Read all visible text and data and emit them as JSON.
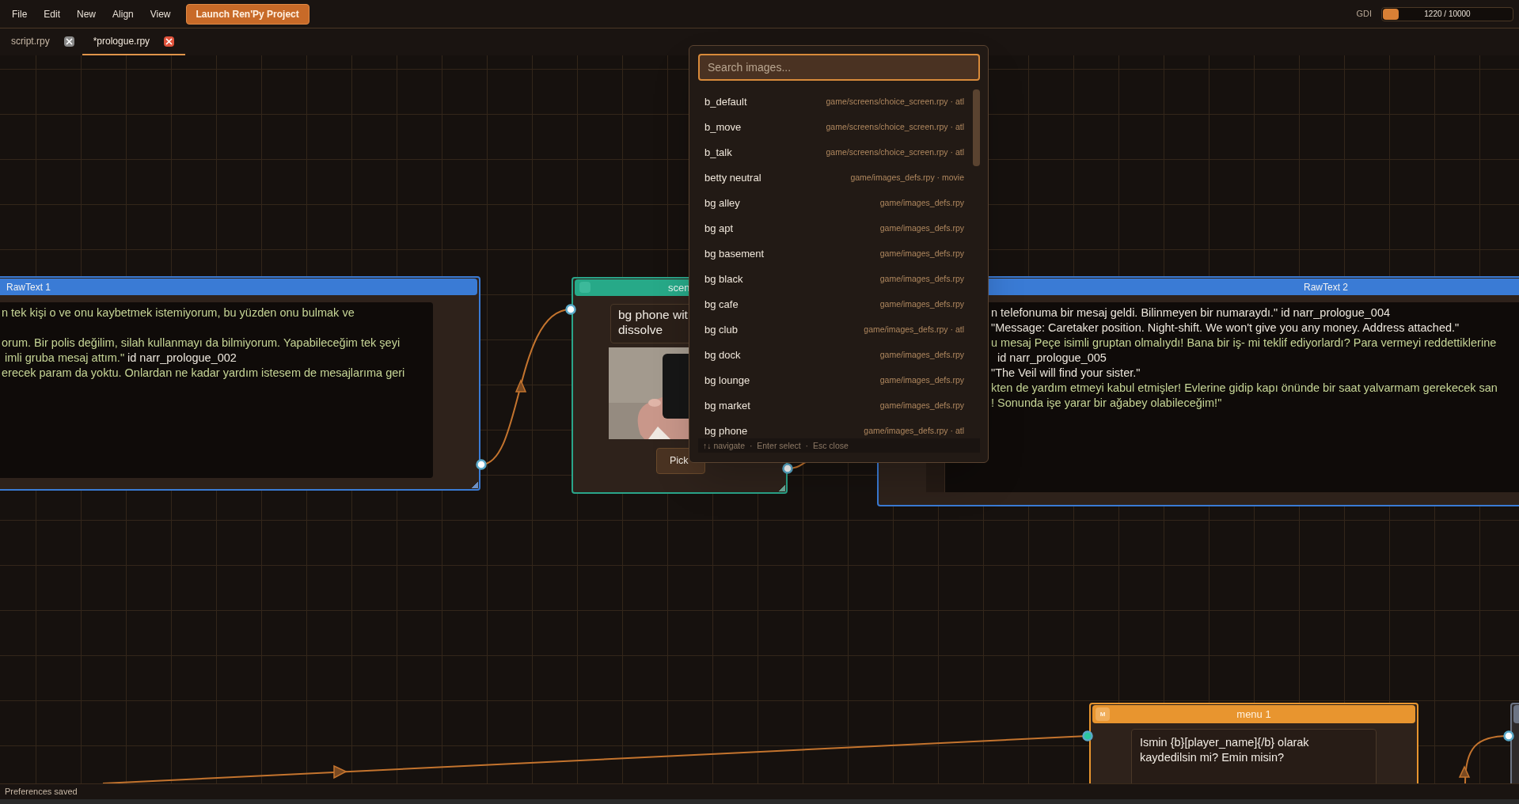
{
  "menu_bar": {
    "items": [
      "File",
      "Edit",
      "New",
      "Align",
      "View"
    ],
    "launch_button": "Launch Ren'Py Project",
    "gdi": {
      "label": "GDI",
      "reading": "1220 / 10000",
      "level": 0.122
    }
  },
  "tabs": [
    {
      "label": "script.rpy",
      "selected": false
    },
    {
      "label": "*prologue.rpy",
      "selected": true
    }
  ],
  "nodes": [
    {
      "kind": "rawtext",
      "title": "RawText 1",
      "lines": [
        {
          "kind": "text",
          "segments": [
            {
              "text": "n tek kişi o ve onu kaybetmek istemiyorum, bu yüzden onu bulmak ve",
              "kind": "string"
            }
          ]
        },
        {
          "kind": "blank"
        },
        {
          "kind": "text",
          "segments": [
            {
              "text": "orum. Bir polis değilim, silah kullanmayı da bilmiyorum. Yapabileceğim tek şeyi",
              "kind": "string"
            }
          ]
        },
        {
          "kind": "text",
          "segments": [
            {
              "text": " imli gruba mesaj attım.\"",
              "kind": "string"
            },
            {
              "text": " id narr_prologue_002",
              "kind": "code"
            }
          ]
        },
        {
          "kind": "text",
          "segments": [
            {
              "text": "erecek param da yoktu. Onlardan ne kadar yardım istesem de mesajlarıma geri",
              "kind": "string"
            }
          ]
        }
      ]
    },
    {
      "kind": "scene",
      "title": "scen",
      "field_lines": [
        "bg phone wit",
        "dissolve"
      ],
      "button": "Pick"
    },
    {
      "kind": "rawtext",
      "title": "RawText 2",
      "lines": [
        {
          "kind": "text",
          "segments": [
            {
              "text": "n telefonuma bir mesaj geldi. Bilinmeyen bir numaraydı.\" id narr_prologue_004",
              "kind": "code"
            }
          ]
        },
        {
          "kind": "text",
          "segments": [
            {
              "text": "\"Message: Caretaker position. Night-shift. We won't give you any money. Address attached.\"",
              "kind": "code"
            }
          ]
        },
        {
          "kind": "text",
          "segments": [
            {
              "text": "u mesaj Peçe isimli gruptan olmalıydı! Bana bir iş- mi teklif ediyorlardı? Para vermeyi reddettiklerine",
              "kind": "string"
            }
          ]
        },
        {
          "kind": "text",
          "segments": [
            {
              "text": "  id narr_prologue_005",
              "kind": "code"
            }
          ]
        },
        {
          "kind": "text",
          "segments": [
            {
              "text": "\"The Veil will find your sister.\"",
              "kind": "code"
            }
          ]
        },
        {
          "kind": "text",
          "segments": [
            {
              "text": "kten de yardım etmeyi kabul etmişler! Evlerine gidip kapı önünde bir saat yalvarmam gerekecek san",
              "kind": "string"
            }
          ]
        },
        {
          "kind": "text",
          "segments": [
            {
              "text": "! Sonunda işe yarar bir ağabey olabileceğim!\"",
              "kind": "string"
            }
          ]
        }
      ]
    },
    {
      "kind": "menu",
      "badge": "M",
      "title": "menu 1",
      "field_lines": [
        "Ismin {b}[player_name]{/b} olarak",
        "kaydedilsin mi? Emin misin?"
      ]
    },
    {
      "kind": "stub"
    }
  ],
  "image_search": {
    "placeholder": "Search images...",
    "results": [
      {
        "name": "b_default",
        "source": "game/screens/choice_screen.rpy · atl"
      },
      {
        "name": "b_move",
        "source": "game/screens/choice_screen.rpy · atl"
      },
      {
        "name": "b_talk",
        "source": "game/screens/choice_screen.rpy · atl"
      },
      {
        "name": "betty neutral",
        "source": "game/images_defs.rpy · movie"
      },
      {
        "name": "bg alley",
        "source": "game/images_defs.rpy"
      },
      {
        "name": "bg apt",
        "source": "game/images_defs.rpy"
      },
      {
        "name": "bg basement",
        "source": "game/images_defs.rpy"
      },
      {
        "name": "bg black",
        "source": "game/images_defs.rpy"
      },
      {
        "name": "bg cafe",
        "source": "game/images_defs.rpy"
      },
      {
        "name": "bg club",
        "source": "game/images_defs.rpy · atl"
      },
      {
        "name": "bg dock",
        "source": "game/images_defs.rpy"
      },
      {
        "name": "bg lounge",
        "source": "game/images_defs.rpy"
      },
      {
        "name": "bg market",
        "source": "game/images_defs.rpy"
      },
      {
        "name": "bg phone",
        "source": "game/images_defs.rpy · atl"
      }
    ],
    "hint": "↑↓ navigate  ·  Enter select  ·  Esc close"
  },
  "status_bar": "Preferences saved"
}
